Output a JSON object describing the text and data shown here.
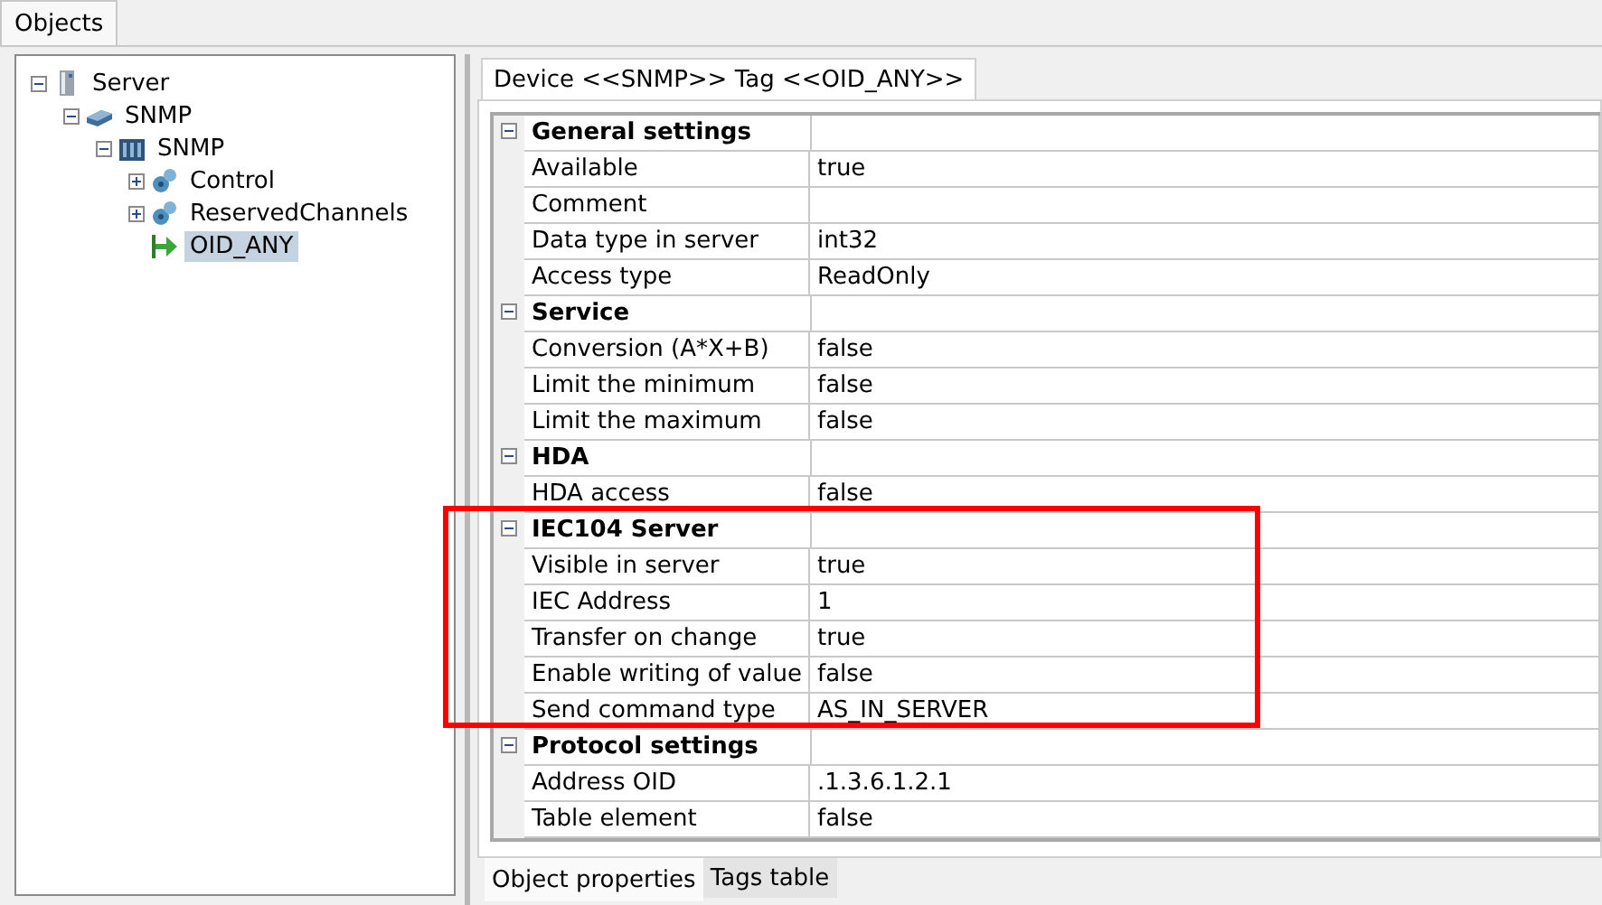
{
  "top_tabs": [
    {
      "label": "Objects",
      "selected": true
    }
  ],
  "tree": [
    {
      "label": "Server",
      "kind": "server",
      "expanded": true,
      "selected": false,
      "children": [
        {
          "label": "SNMP",
          "kind": "device",
          "expanded": true,
          "selected": false,
          "children": [
            {
              "label": "SNMP",
              "kind": "module",
              "expanded": true,
              "selected": false,
              "children": [
                {
                  "label": "Control",
                  "kind": "group",
                  "expanded": false,
                  "selected": false
                },
                {
                  "label": "ReservedChannels",
                  "kind": "group",
                  "expanded": false,
                  "selected": false
                },
                {
                  "label": "OID_ANY",
                  "kind": "tag",
                  "selected": true
                }
              ]
            }
          ]
        }
      ]
    }
  ],
  "panel_tabs": [
    {
      "label": "Device <<SNMP>> Tag <<OID_ANY>>",
      "selected": true
    }
  ],
  "sections": [
    {
      "title": "General settings",
      "expanded": true,
      "rows": [
        {
          "name": "Available",
          "value": "true"
        },
        {
          "name": "Comment"
        },
        {
          "name": "Data type in server",
          "value": "int32"
        },
        {
          "name": "Access type",
          "value": "ReadOnly"
        }
      ]
    },
    {
      "title": "Service",
      "expanded": true,
      "rows": [
        {
          "name": "Conversion (A*X+B)",
          "value": "false"
        },
        {
          "name": "Limit the minimum",
          "value": "false"
        },
        {
          "name": "Limit the maximum",
          "value": "false"
        }
      ]
    },
    {
      "title": "HDA",
      "expanded": true,
      "rows": [
        {
          "name": "HDA access",
          "value": "false"
        }
      ]
    },
    {
      "title": "IEC104 Server",
      "expanded": true,
      "rows": [
        {
          "name": "Visible in server",
          "value": "true"
        },
        {
          "name": "IEC Address",
          "value": "1"
        },
        {
          "name": "Transfer on change",
          "value": "true"
        },
        {
          "name": "Enable writing of value",
          "value": "false"
        },
        {
          "name": "Send command type",
          "value": "AS_IN_SERVER"
        }
      ]
    },
    {
      "title": "Protocol settings",
      "expanded": true,
      "rows": [
        {
          "name": "Address OID",
          "value": ".1.3.6.1.2.1"
        },
        {
          "name": "Table element",
          "value": "false"
        }
      ]
    }
  ],
  "bottom_tabs": [
    {
      "label": "Object properties",
      "selected": true
    },
    {
      "label": "Tags table",
      "selected": false
    }
  ]
}
